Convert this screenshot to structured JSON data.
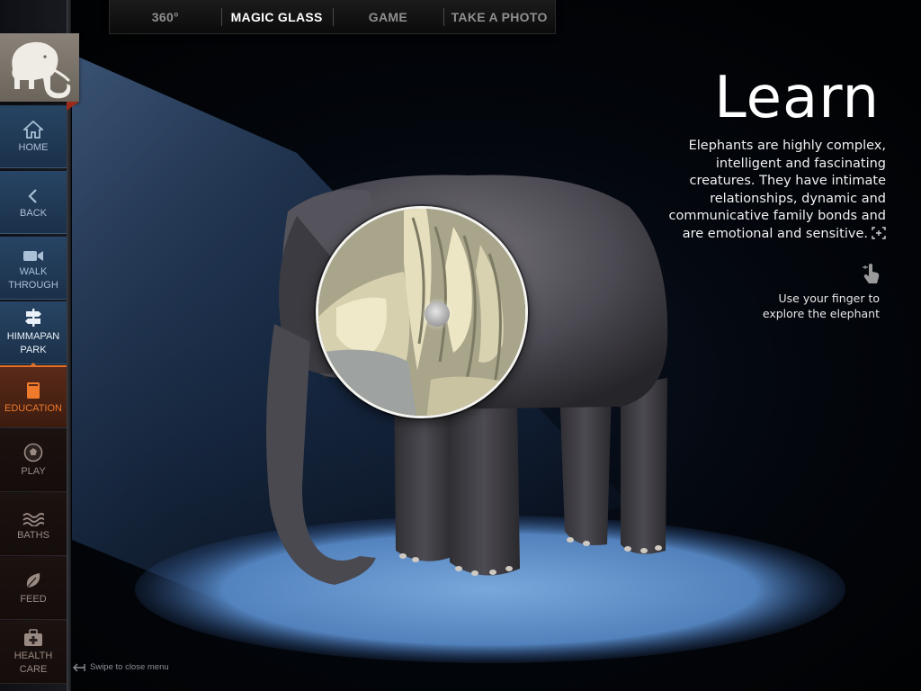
{
  "top_tabs": [
    {
      "label": "360°",
      "active": false
    },
    {
      "label": "MAGIC GLASS",
      "active": true
    },
    {
      "label": "GAME",
      "active": false
    },
    {
      "label": "TAKE A PHOTO",
      "active": false
    }
  ],
  "logo": {
    "icon": "mammoth-logo-icon",
    "color": "#7a736a"
  },
  "sidebar": {
    "items": [
      {
        "label": "HOME",
        "icon": "home-icon"
      },
      {
        "label": "BACK",
        "icon": "chevron-left-icon"
      },
      {
        "label": "WALK\nTHROUGH",
        "icon": "video-camera-icon"
      },
      {
        "label": "HIMMAPAN\nPARK",
        "icon": "signpost-icon"
      },
      {
        "label": "EDUCATION",
        "icon": "book-icon",
        "active": true
      },
      {
        "label": "PLAY",
        "icon": "soccer-ball-icon"
      },
      {
        "label": "BATHS",
        "icon": "water-waves-icon"
      },
      {
        "label": "FEED",
        "icon": "leaf-icon"
      },
      {
        "label": "HEALTH\nCARE",
        "icon": "medical-kit-icon"
      }
    ]
  },
  "learn": {
    "title": "Learn",
    "body": "Elephants are highly complex, intelligent and fascinating creatures. They have intimate relationships, dynamic and communicative family bonds and are emotional and sensitive.",
    "hint": "Use your finger to explore the elephant"
  },
  "footer": {
    "swipe_hint": "Swipe to close menu"
  },
  "colors": {
    "accent": "#e2702a",
    "nav_blue": "#274564",
    "spotlight": "#5f8fc8",
    "background": "#020306"
  }
}
